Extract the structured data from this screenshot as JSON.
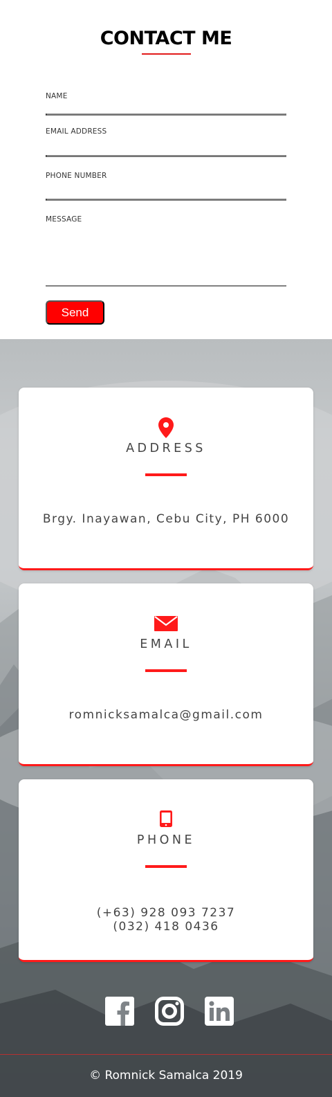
{
  "form": {
    "title": "CONTACT ME",
    "fields": {
      "name_label": "NAME",
      "email_label": "EMAIL ADDRESS",
      "phone_label": "PHONE NUMBER",
      "message_label": "MESSAGE"
    },
    "send_label": "Send"
  },
  "cards": {
    "address": {
      "icon": "map-pin-icon",
      "title": "ADDRESS",
      "text": "Brgy. Inayawan, Cebu City, PH 6000"
    },
    "email": {
      "icon": "envelope-icon",
      "title": "EMAIL",
      "text": "romnicksamalca@gmail.com"
    },
    "phone": {
      "icon": "mobile-phone-icon",
      "title": "PHONE",
      "line1": "(+63) 928 093 7237",
      "line2": "(032) 418 0436"
    }
  },
  "social": [
    "facebook-icon",
    "instagram-icon",
    "linkedin-icon"
  ],
  "footer": {
    "text": "© Romnick Samalca 2019"
  },
  "colors": {
    "accent": "#ff1a1a",
    "text": "#444444"
  }
}
